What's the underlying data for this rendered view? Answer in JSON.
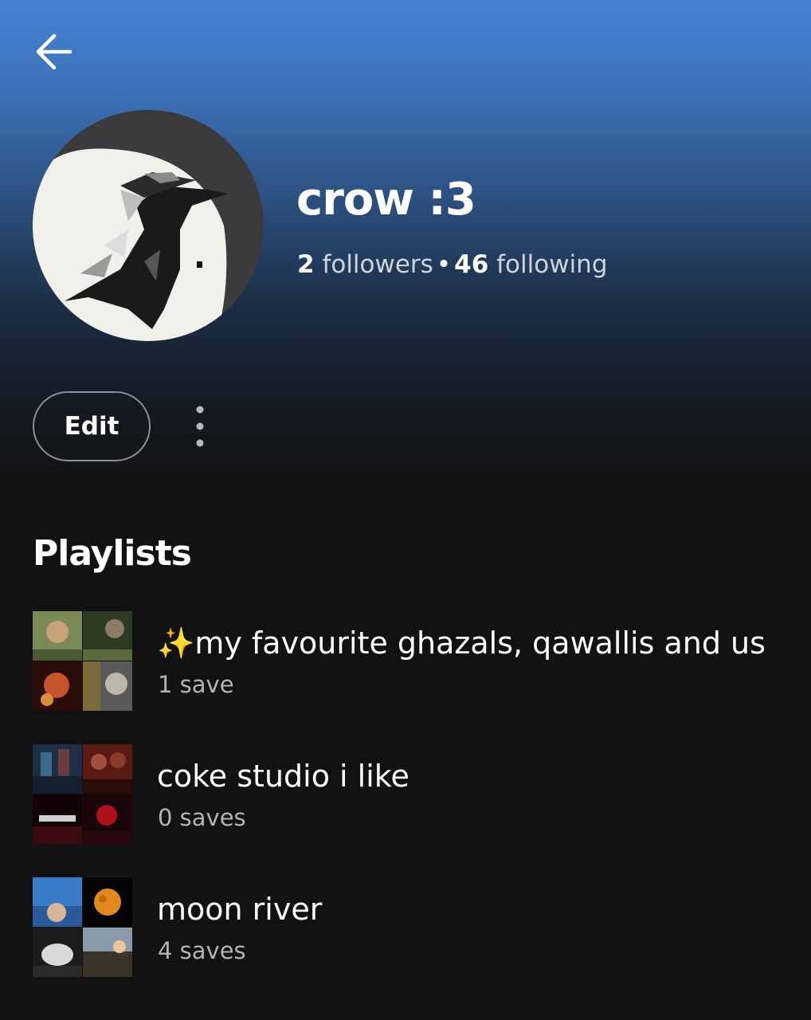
{
  "profile": {
    "display_name": "crow :3",
    "followers_count": "2",
    "followers_label": "followers",
    "separator": "•",
    "following_count": "46",
    "following_label": "following",
    "avatar_icon": "crow-avatar"
  },
  "actions": {
    "back_icon": "arrow-left-icon",
    "edit_label": "Edit",
    "more_icon": "more-vertical-icon"
  },
  "playlists_section": {
    "title": "Playlists",
    "items": [
      {
        "title": "✨my favourite ghazals, qawallis and us ...",
        "saves": "1 save"
      },
      {
        "title": "coke studio i like",
        "saves": "0 saves"
      },
      {
        "title": "moon river",
        "saves": "4 saves"
      }
    ]
  },
  "colors": {
    "gradient_top": "#4484d6",
    "background": "#121212",
    "secondary_text": "#b3b3b3"
  }
}
